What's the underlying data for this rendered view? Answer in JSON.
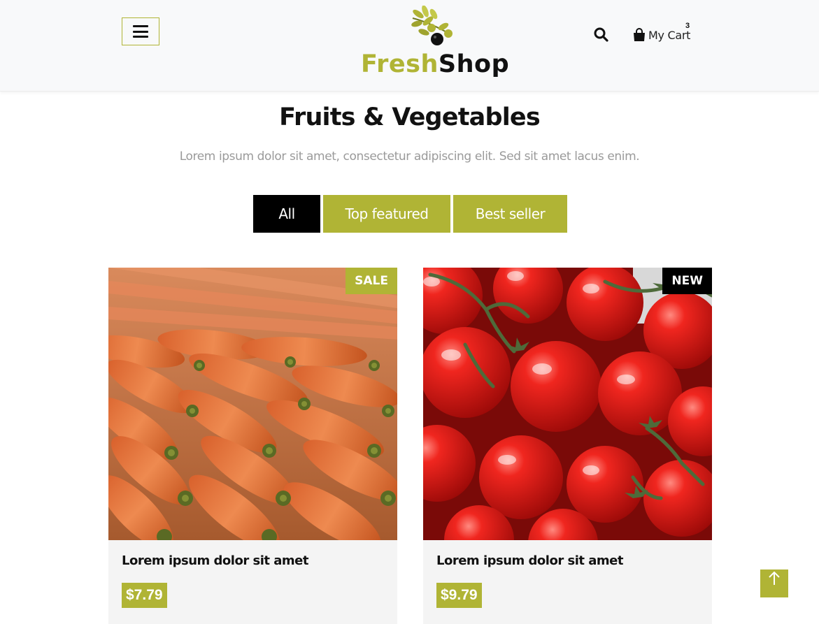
{
  "header": {
    "logo": {
      "word1": "Fresh",
      "word2": "Shop"
    },
    "cart": {
      "label": "My Cart",
      "count": "3"
    }
  },
  "section": {
    "title": "Fruits & Vegetables",
    "subtitle": "Lorem ipsum dolor sit amet, consectetur adipiscing elit. Sed sit amet lacus enim."
  },
  "filters": [
    {
      "label": "All",
      "active": true
    },
    {
      "label": "Top featured",
      "active": false
    },
    {
      "label": "Best seller",
      "active": false
    }
  ],
  "products": [
    {
      "image": "carrots",
      "badge": "SALE",
      "title": "Lorem ipsum dolor sit amet",
      "price": "$7.79"
    },
    {
      "image": "tomatoes",
      "badge": "NEW",
      "title": "Lorem ipsum dolor sit amet",
      "price": "$9.79"
    }
  ],
  "colors": {
    "accent": "#b0b435",
    "dark": "#000000",
    "header_bg": "#f8f9fa",
    "card_bg": "#f4f4f4"
  },
  "icons": [
    "hamburger-icon",
    "search-icon",
    "shopping-bag-icon",
    "arrow-up-icon"
  ]
}
